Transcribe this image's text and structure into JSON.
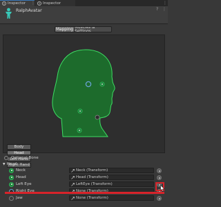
{
  "tabs": [
    {
      "label": "Inspector",
      "active": true
    },
    {
      "label": "Inspector",
      "active": false
    }
  ],
  "header": {
    "title": "RalphAvatar"
  },
  "modes": {
    "mapping": "Mapping",
    "muscles": "Muscles & Settings"
  },
  "body_buttons": [
    "Body",
    "Head",
    "Left Hand",
    "Right Hand"
  ],
  "optional_bone": "Optional Bone",
  "group_label": "Head",
  "bones": [
    {
      "name": "Neck",
      "value": "Neck (Transform)",
      "state": "green"
    },
    {
      "name": "Head",
      "value": "Head (Transform)",
      "state": "green"
    },
    {
      "name": "Left Eye",
      "value": "LeftEye (Transform)",
      "state": "green"
    },
    {
      "name": "Right Eye",
      "value": "None (Transform)",
      "state": "blue"
    },
    {
      "name": "Jaw",
      "value": "None (Transform)",
      "state": "grey"
    }
  ],
  "colors": {
    "accent": "#3a79bb",
    "mapped": "#2fb75a",
    "selected": "#6aa3d6",
    "annotation": "#d8232a",
    "head_fill": "#1d6b2c"
  }
}
